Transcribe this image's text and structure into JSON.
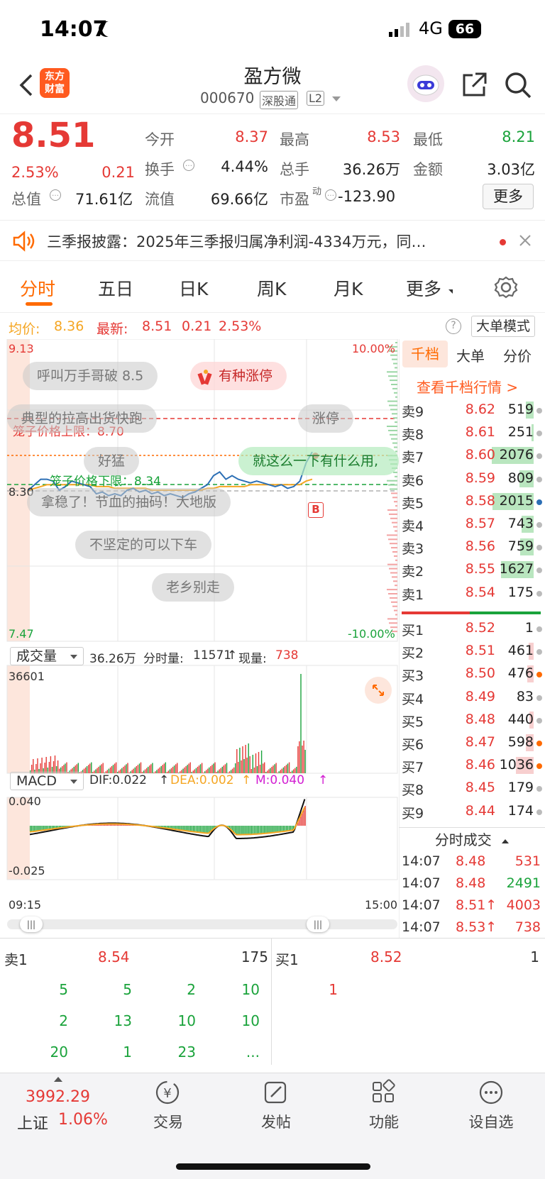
{
  "status_bar": {
    "time": "14:07",
    "network": "4G",
    "battery": "66"
  },
  "header": {
    "logo_line1": "东方",
    "logo_line2": "财富",
    "stock_name": "盈方微",
    "stock_code": "000670",
    "tag1": "深股通",
    "tag2": "L2"
  },
  "quote": {
    "price": "8.51",
    "change_pct": "2.53%",
    "change_amt": "0.21",
    "open_label": "今开",
    "open": "8.37",
    "high_label": "最高",
    "high": "8.53",
    "low_label": "最低",
    "low": "8.21",
    "turnover_label": "换手",
    "turnover": "4.44%",
    "volume_label": "总手",
    "volume": "36.26万",
    "amount_label": "金额",
    "amount": "3.03亿",
    "mktcap_label": "总值",
    "mktcap": "71.61亿",
    "float_label": "流值",
    "float": "69.66亿",
    "pe_label": "市盈",
    "pe_sup": "动",
    "pe": "-123.90",
    "more_button": "更多"
  },
  "notice": {
    "text": "三季报披露：2025年三季报归属净利润-4334万元，同…"
  },
  "tabs": [
    "分时",
    "五日",
    "日K",
    "周K",
    "月K",
    "更多"
  ],
  "info_line": {
    "avg_label": "均价:",
    "avg": "8.36",
    "latest_label": "最新:",
    "latest": "8.51",
    "chg": "0.21",
    "pct": "2.53%",
    "big_order_mode": "大单模式"
  },
  "chart": {
    "y_max": "9.13",
    "y_min": "7.47",
    "y_ref": "8.30",
    "pct_max": "10.00%",
    "pct_min": "-10.00%",
    "cage_upper": "笼子价格上限：8.70",
    "cage_lower": "笼子价格下限：8.34",
    "buy_marker": "B",
    "time_start": "09:15",
    "time_end": "15:00"
  },
  "barrage": [
    "呼叫万手哥破 8.5",
    "有种涨停",
    "典型的拉高出货快跑",
    "涨停",
    "好猛",
    "就这么一下有什么用,",
    "拿稳了！节血的抽码！大地版",
    "不坚定的可以下车",
    "老乡别走"
  ],
  "volume_panel": {
    "selector": "成交量",
    "total": "36.26万",
    "per_min_label": "分时量:",
    "per_min": "11571",
    "now_label": "现量:",
    "now": "738",
    "max": "36601"
  },
  "macd_panel": {
    "selector": "MACD",
    "dif": "DIF:0.022",
    "dea": "DEA:0.002",
    "m": "M:0.040",
    "max": "0.040",
    "min": "-0.025"
  },
  "chart_data": {
    "type": "line",
    "title": "",
    "ylim": [
      7.47,
      9.13
    ],
    "y_ref": 8.3,
    "price_series": [
      8.3,
      8.33,
      8.36,
      8.36,
      8.35,
      8.3,
      8.32,
      8.35,
      8.34,
      8.33,
      8.32,
      8.28,
      8.29,
      8.27,
      8.28,
      8.27,
      8.3,
      8.31,
      8.29,
      8.3,
      8.28,
      8.29,
      8.27,
      8.28,
      8.27,
      8.26,
      8.28,
      8.29,
      8.31,
      8.33,
      8.38,
      8.4,
      8.36,
      8.38,
      8.36,
      8.35,
      8.34,
      8.35,
      8.34,
      8.33,
      8.32,
      8.33,
      8.31,
      8.32,
      8.35,
      8.45,
      8.51
    ],
    "avg_series": [
      8.3,
      8.31,
      8.32,
      8.33,
      8.33,
      8.33,
      8.33,
      8.33,
      8.33,
      8.33,
      8.33,
      8.32,
      8.32,
      8.32,
      8.31,
      8.31,
      8.31,
      8.31,
      8.31,
      8.31,
      8.3,
      8.3,
      8.3,
      8.3,
      8.3,
      8.3,
      8.3,
      8.3,
      8.3,
      8.31,
      8.31,
      8.32,
      8.32,
      8.32,
      8.32,
      8.32,
      8.33,
      8.33,
      8.33,
      8.33,
      8.33,
      8.33,
      8.33,
      8.33,
      8.33,
      8.35,
      8.36
    ]
  },
  "orderbook": {
    "tabs": [
      "千档",
      "大单",
      "分价"
    ],
    "link": "查看千档行情 >",
    "asks": [
      {
        "label": "卖9",
        "price": "8.62",
        "qty": "519",
        "dot": "gray",
        "bar": 0.18
      },
      {
        "label": "卖8",
        "price": "8.61",
        "qty": "251",
        "dot": "gray",
        "bar": 0.05
      },
      {
        "label": "卖7",
        "price": "8.60",
        "qty": "2076",
        "dot": "gray",
        "bar": 0.95
      },
      {
        "label": "卖6",
        "price": "8.59",
        "qty": "809",
        "dot": "gray",
        "bar": 0.32
      },
      {
        "label": "卖5",
        "price": "8.58",
        "qty": "2015",
        "dot": "blue",
        "bar": 0.93
      },
      {
        "label": "卖4",
        "price": "8.57",
        "qty": "743",
        "dot": "gray",
        "bar": 0.28
      },
      {
        "label": "卖3",
        "price": "8.56",
        "qty": "759",
        "dot": "gray",
        "bar": 0.3
      },
      {
        "label": "卖2",
        "price": "8.55",
        "qty": "1627",
        "dot": "gray",
        "bar": 0.75
      },
      {
        "label": "卖1",
        "price": "8.54",
        "qty": "175",
        "dot": "gray",
        "bar": 0.0
      }
    ],
    "bids": [
      {
        "label": "买1",
        "price": "8.52",
        "qty": "1",
        "dot": "gray",
        "bar": 0.0
      },
      {
        "label": "买2",
        "price": "8.51",
        "qty": "461",
        "dot": "gray",
        "bar": 0.12
      },
      {
        "label": "买3",
        "price": "8.50",
        "qty": "476",
        "dot": "orange",
        "bar": 0.14
      },
      {
        "label": "买4",
        "price": "8.49",
        "qty": "83",
        "dot": "gray",
        "bar": 0.0
      },
      {
        "label": "买5",
        "price": "8.48",
        "qty": "440",
        "dot": "gray",
        "bar": 0.1
      },
      {
        "label": "买6",
        "price": "8.47",
        "qty": "598",
        "dot": "orange",
        "bar": 0.18
      },
      {
        "label": "买7",
        "price": "8.46",
        "qty": "1036",
        "dot": "orange",
        "bar": 0.4
      },
      {
        "label": "买8",
        "price": "8.45",
        "qty": "179",
        "dot": "gray",
        "bar": 0.0
      },
      {
        "label": "买9",
        "price": "8.44",
        "qty": "174",
        "dot": "gray",
        "bar": 0.0
      }
    ],
    "ticks_title": "分时成交",
    "ticks": [
      {
        "time": "14:07",
        "price": "8.48",
        "qty": "531",
        "color": "red"
      },
      {
        "time": "14:07",
        "price": "8.48",
        "qty": "2491",
        "color": "green"
      },
      {
        "time": "14:07",
        "price": "8.51↑",
        "qty": "4003",
        "color": "red"
      },
      {
        "time": "14:07",
        "price": "8.53↑",
        "qty": "738",
        "color": "red"
      }
    ]
  },
  "queue": {
    "ask_label": "卖1",
    "ask_price": "8.54",
    "ask_qty": "175",
    "bid_label": "买1",
    "bid_price": "8.52",
    "bid_qty": "1",
    "ask_rows": [
      [
        "5",
        "5",
        "2",
        "10"
      ],
      [
        "2",
        "13",
        "10",
        "10"
      ],
      [
        "20",
        "1",
        "23",
        "..."
      ]
    ],
    "bid_rows": [
      [
        "1"
      ]
    ]
  },
  "bottom": {
    "index_value": "3992.29",
    "index_name": "上证",
    "index_pct": "1.06%",
    "trade": "交易",
    "post": "发帖",
    "func": "功能",
    "watch": "设自选"
  },
  "colors": {
    "up": "#e53935",
    "down": "#1aa33b",
    "accent": "#ff6a00",
    "avg_line": "#f5a623",
    "price_line": "#2c6fb5"
  }
}
